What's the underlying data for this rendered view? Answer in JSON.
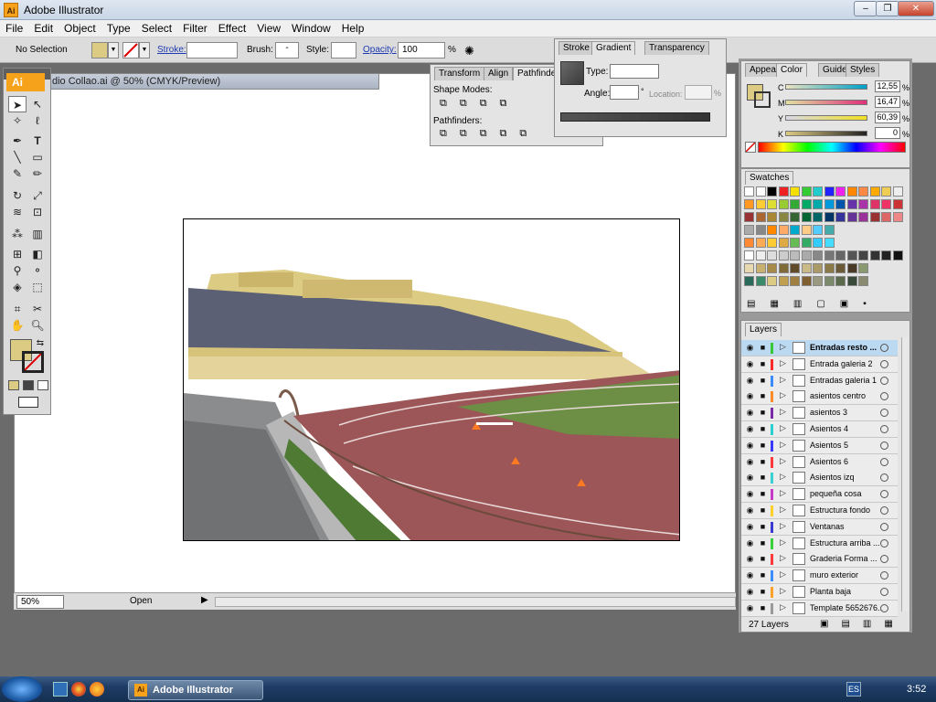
{
  "app": {
    "title": "Adobe Illustrator",
    "icon_text": "Ai"
  },
  "menu": [
    "File",
    "Edit",
    "Object",
    "Type",
    "Select",
    "Filter",
    "Effect",
    "View",
    "Window",
    "Help"
  ],
  "control": {
    "selection": "No Selection",
    "stroke_label": "Stroke:",
    "brush_label": "Brush:",
    "brush_value": "-",
    "style_label": "Style:",
    "opacity_label": "Opacity:",
    "opacity_value": "100",
    "percent": "%"
  },
  "document": {
    "tab_title": "dio Collao.ai @ 50% (CMYK/Preview)",
    "zoom": "50%",
    "status": "Open"
  },
  "tools_panel": {
    "logo": "Ai"
  },
  "pathfinder_panel": {
    "tabs": [
      "Transform",
      "Align",
      "Pathfinder"
    ],
    "shape_modes_label": "Shape Modes:",
    "pathfinders_label": "Pathfinders:"
  },
  "gradient_panel": {
    "tabs": [
      "Stroke",
      "Gradient",
      "Transparency"
    ],
    "type_label": "Type:",
    "angle_label": "Angle:",
    "location_label": "Location:",
    "percent": "%",
    "degree": "°"
  },
  "color_panel": {
    "tabs": [
      "Appea",
      "Color",
      "Guide",
      "Styles"
    ],
    "channels": [
      {
        "label": "C",
        "value": "12,55",
        "fraction": 0.1255
      },
      {
        "label": "M",
        "value": "16,47",
        "fraction": 0.1647
      },
      {
        "label": "Y",
        "value": "60,39",
        "fraction": 0.6039
      },
      {
        "label": "K",
        "value": "0",
        "fraction": 0
      }
    ],
    "percent": "%",
    "fill_color": "#dccb82"
  },
  "swatches_panel": {
    "tab": "Swatches"
  },
  "layers_panel": {
    "tab": "Layers",
    "count_label": "27 Layers",
    "layers": [
      {
        "name": "Entradas resto ...",
        "color": "#37c837",
        "selected": true
      },
      {
        "name": "Entrada galeria 2",
        "color": "#ff2a2a"
      },
      {
        "name": "Entradas galeria 1",
        "color": "#3a8cff"
      },
      {
        "name": "asientos centro",
        "color": "#ff8a2a"
      },
      {
        "name": "asientos 3",
        "color": "#7a2aa8"
      },
      {
        "name": "Asientos 4",
        "color": "#2ad0d0"
      },
      {
        "name": "Asientos 5",
        "color": "#3a3aff"
      },
      {
        "name": "Asientos 6",
        "color": "#ff3a3a"
      },
      {
        "name": "Asientos izq",
        "color": "#3ad0d0"
      },
      {
        "name": "pequeña cosa",
        "color": "#c83ac8"
      },
      {
        "name": "Estructura fondo",
        "color": "#ffd02a"
      },
      {
        "name": "Ventanas",
        "color": "#3a3ad0"
      },
      {
        "name": "Estructura arriba ...",
        "color": "#3ad03a"
      },
      {
        "name": "Graderia Forma ...",
        "color": "#ff3a3a"
      },
      {
        "name": "muro exterior",
        "color": "#3a8cff"
      },
      {
        "name": "Planta baja",
        "color": "#ffa02a"
      },
      {
        "name": "Template 5652676...",
        "color": "#9a9a9a"
      }
    ]
  },
  "taskbar": {
    "app_label": "Adobe Illustrator",
    "lang": "ES",
    "time": "3:52"
  }
}
